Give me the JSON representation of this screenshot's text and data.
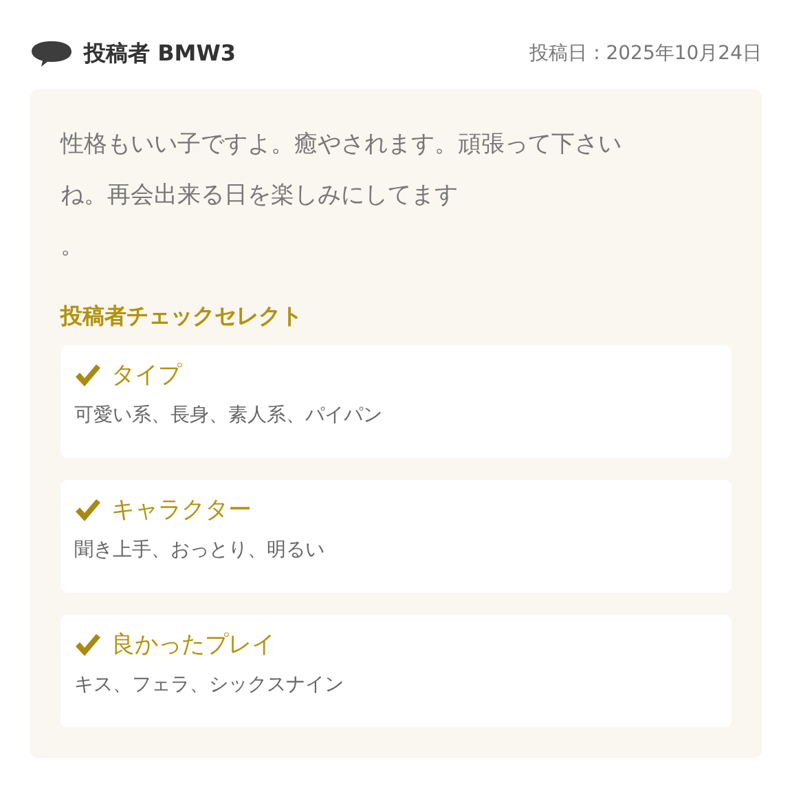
{
  "header": {
    "poster": "投稿者 BMW3",
    "date": "投稿日 : 2025年10月24日"
  },
  "comment": {
    "lines": [
      "性格もいい子ですよ。癒やされます。頑張って下さい",
      "ね。再会出来る日を楽しみにしてます",
      "。"
    ]
  },
  "check_select": {
    "title": "投稿者チェックセレクト",
    "items": [
      {
        "label": "タイプ",
        "value": "可愛い系、長身、素人系、パイパン"
      },
      {
        "label": "キャラクター",
        "value": "聞き上手、おっとり、明るい"
      },
      {
        "label": "良かったプレイ",
        "value": "キス、フェラ、シックスナイン"
      }
    ]
  }
}
